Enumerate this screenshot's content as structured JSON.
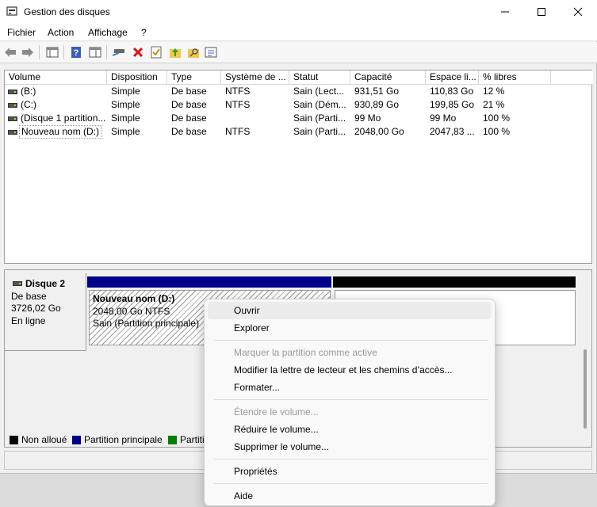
{
  "window": {
    "title": "Gestion des disques",
    "controls": {
      "minimize": "—",
      "maximize": "☐",
      "close": "✕"
    }
  },
  "menubar": [
    "Fichier",
    "Action",
    "Affichage",
    "?"
  ],
  "toolbar": {
    "icons": [
      "back-arrow-icon",
      "forward-arrow-icon",
      "console-tree-icon",
      "help-icon",
      "show-pane-icon",
      "connect-drive-icon",
      "delete-icon",
      "checklist-icon",
      "folder-up-icon",
      "folder-search-icon",
      "properties-icon"
    ]
  },
  "volume_list": {
    "columns": [
      "Volume",
      "Disposition",
      "Type",
      "Système de ...",
      "Statut",
      "Capacité",
      "Espace li...",
      "% libres"
    ],
    "rows": [
      [
        "(B:)",
        "Simple",
        "De base",
        "NTFS",
        "Sain (Lect...",
        "931,51 Go",
        "110,83 Go",
        "12 %"
      ],
      [
        "(C:)",
        "Simple",
        "De base",
        "NTFS",
        "Sain (Dém...",
        "930,89 Go",
        "199,85 Go",
        "21 %"
      ],
      [
        "(Disque 1 partition...",
        "Simple",
        "De base",
        "",
        "Sain (Parti...",
        "99 Mo",
        "99 Mo",
        "100 %"
      ],
      [
        "Nouveau nom (D:)",
        "Simple",
        "De base",
        "NTFS",
        "Sain (Parti...",
        "2048,00 Go",
        "2047,83 ...",
        "100 %"
      ]
    ]
  },
  "disk": {
    "name": "Disque 2",
    "type": "De base",
    "size": "3726,02 Go",
    "state": "En ligne",
    "partition": {
      "name": "Nouveau nom  (D:)",
      "size_fs": "2048,00 Go NTFS",
      "status": "Sain (Partition principale)"
    }
  },
  "legend": [
    {
      "label": "Non alloué",
      "color": "#000000"
    },
    {
      "label": "Partition principale",
      "color": "#00008b"
    },
    {
      "label": "Partiti",
      "color": "#008000"
    }
  ],
  "context_menu": {
    "items": [
      {
        "label": "Ouvrir",
        "enabled": true
      },
      {
        "label": "Explorer",
        "enabled": true
      },
      {
        "label": "Marquer la partition comme active",
        "enabled": false
      },
      {
        "label": "Modifier la lettre de lecteur et les chemins d’accès...",
        "enabled": true
      },
      {
        "label": "Formater...",
        "enabled": true
      },
      {
        "label": "Étendre le volume...",
        "enabled": false
      },
      {
        "label": "Réduire le volume...",
        "enabled": true
      },
      {
        "label": "Supprimer le volume...",
        "enabled": true
      },
      {
        "label": "Propriétés",
        "enabled": true
      },
      {
        "label": "Aide",
        "enabled": true
      }
    ]
  }
}
